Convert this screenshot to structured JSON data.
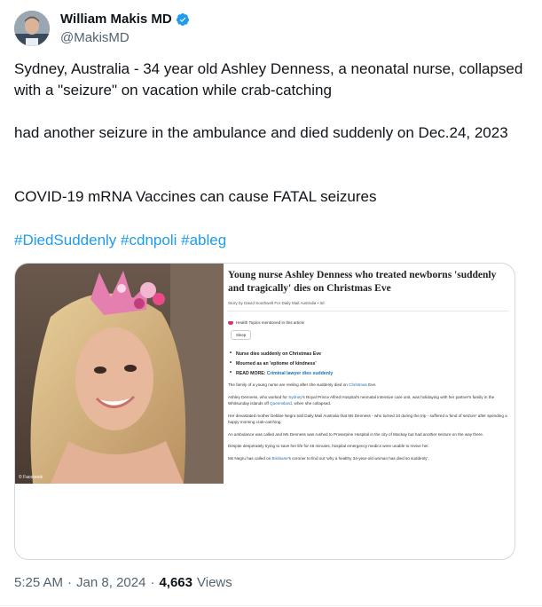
{
  "author": {
    "display_name": "William Makis MD",
    "handle": "@MakisMD",
    "verified_color": "#1d9bf0"
  },
  "tweet": {
    "paragraph1": "Sydney, Australia - 34 year old Ashley Denness, a neonatal nurse, collapsed with a \"seizure\" on vacation while crab-catching",
    "paragraph2": "had another seizure in the ambulance and died suddenly on Dec.24, 2023",
    "paragraph3": "COVID-19 mRNA Vaccines can cause FATAL seizures",
    "hashtags": [
      "#DiedSuddenly",
      "#cdnpoli",
      "#ableg"
    ]
  },
  "card": {
    "photo_credit": "© Facebook",
    "article": {
      "title": "Young nurse Ashley Denness who treated newborns 'suddenly and tragically' dies on Christmas Eve",
      "byline": "Story by David Southwell For Daily Mail Australia • 3d",
      "health_topics_label": "Health Topics mentioned in this article",
      "topic_chip": "Sleep",
      "bullets": [
        "Nurse dies suddenly on Christmas Eve",
        "Mourned as an 'epitome of kindness'"
      ],
      "read_more_label": "READ MORE:",
      "read_more_link": "Criminal lawyer dies suddenly",
      "para1_text": "The family of a young nurse are reeling after she suddenly died on",
      "para1_link": "Christmas",
      "para1_end": "Eve.",
      "para2_a": "Ashley Denness, who worked for",
      "para2_link1": "Sydney",
      "para2_b": "'s Royal Prince Alfred Hospital's neonatal intensive care unit, was holidaying with her partner's family in the Whitsunday islands off",
      "para2_link2": "Queensland",
      "para2_c": ", when she collapsed.",
      "para3": "Her devastated mother Debbie Negru told Daily Mail Australia that Ms Denness - who turned 34 during the trip - suffered a 'kind of seizure' after spending a happy morning crab-catching.",
      "para4": "An ambulance was called and Ms Denness was rushed to Proserpine Hospital in the city of Mackay but had another seizure on the way there.",
      "para5": "Despite desperately trying to save her life for 45 minutes, hospital emergency medics were unable to revive her.",
      "para6_a": "Ms Negru has called on",
      "para6_link": "Brisbane",
      "para6_b": "'s coroner to find out 'why a healthy 34-year-old woman has died so suddenly'."
    }
  },
  "meta": {
    "time": "5:25 AM",
    "sep": "·",
    "date": "Jan 8, 2024",
    "views_count": "4,663",
    "views_label": "Views"
  }
}
